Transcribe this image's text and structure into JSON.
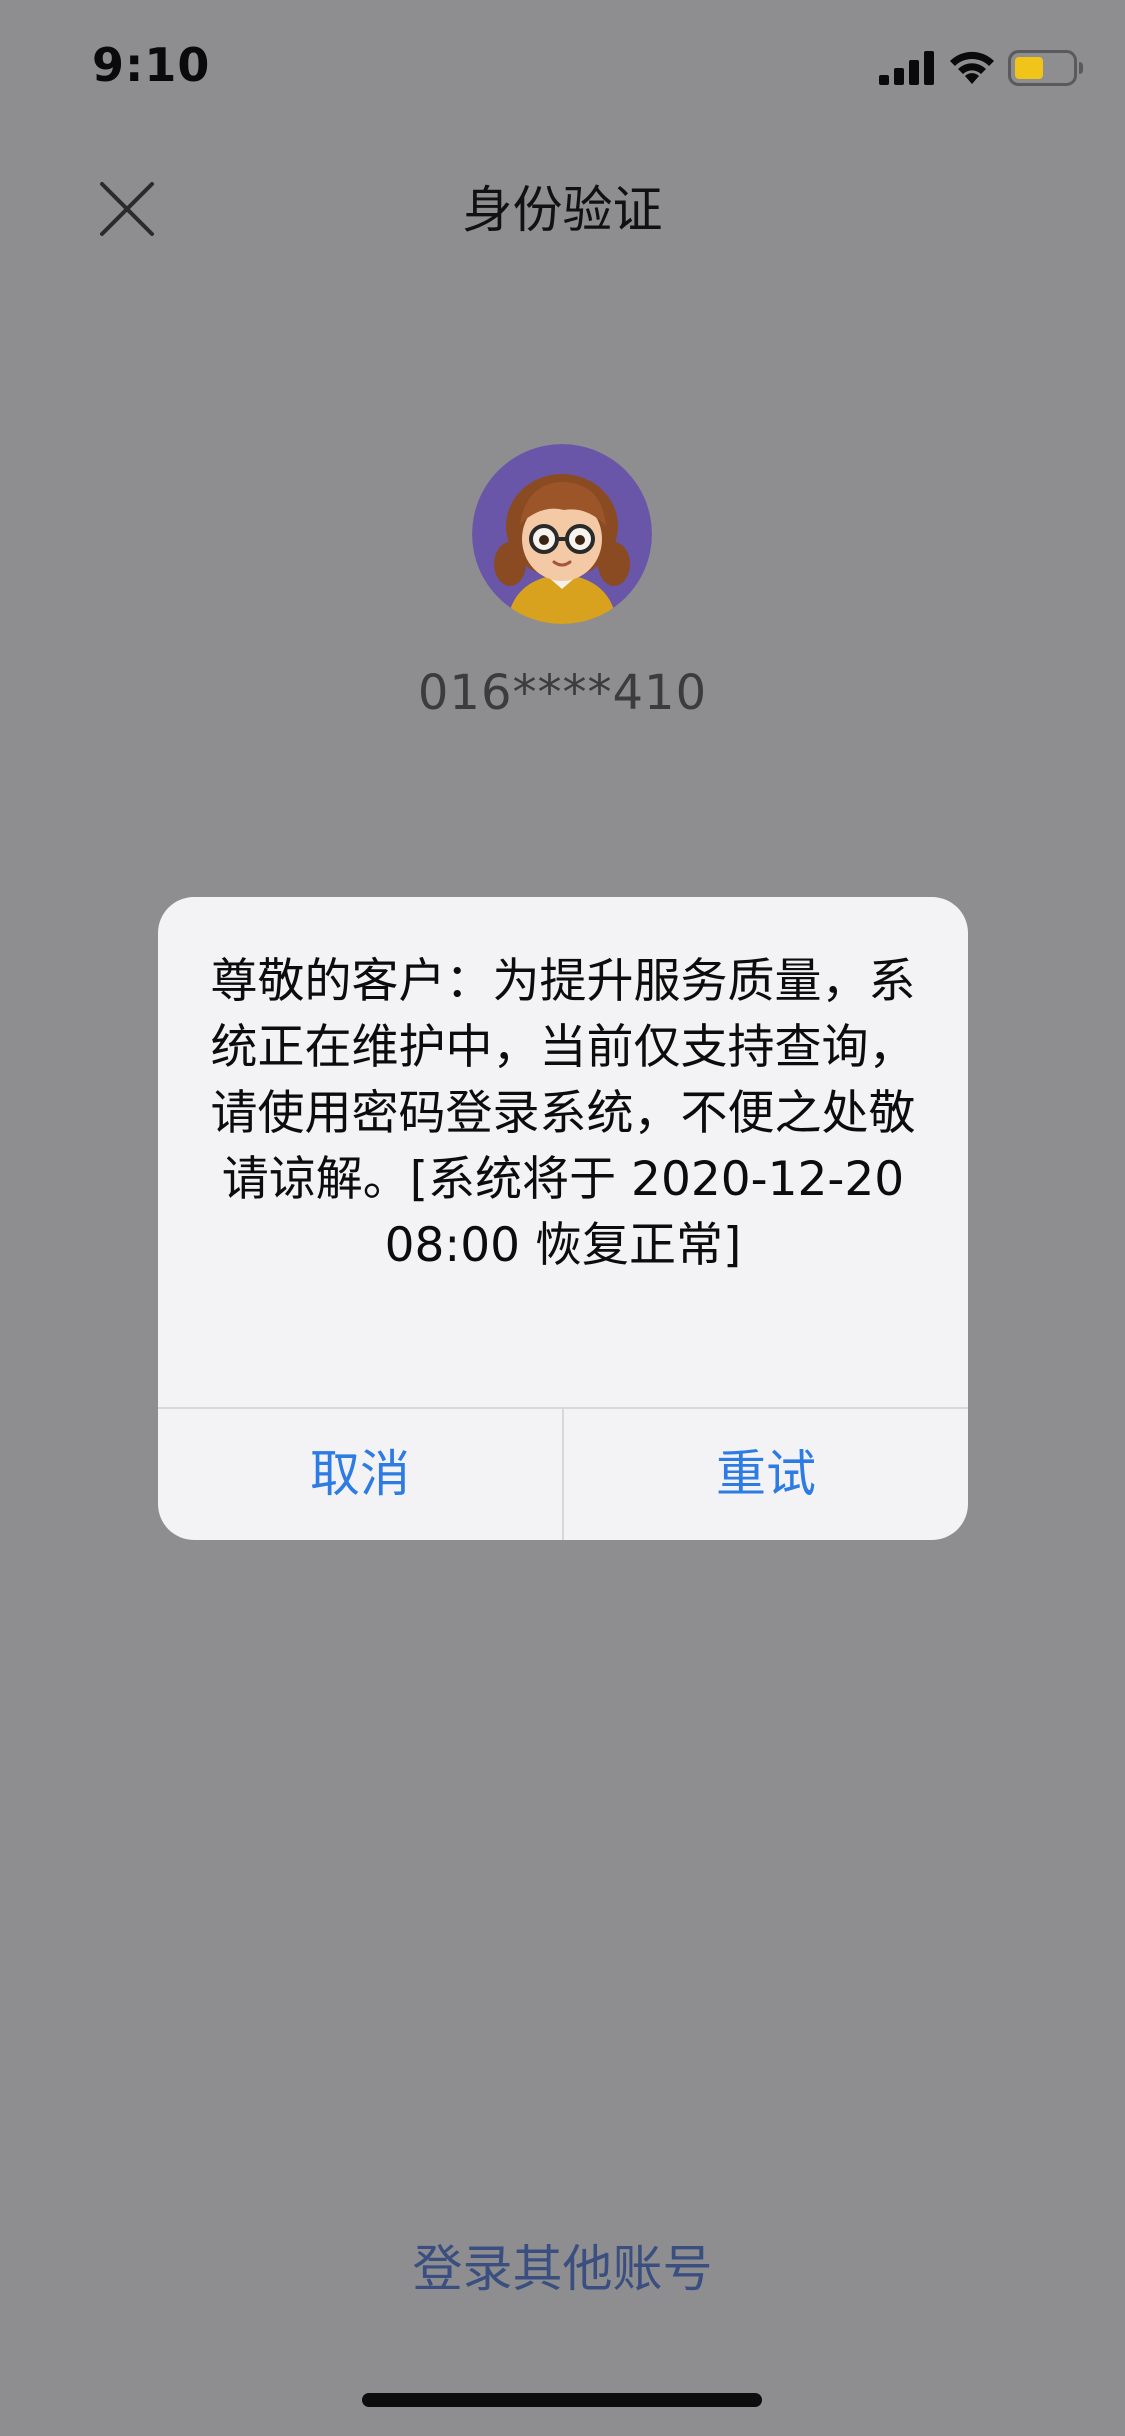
{
  "status_bar": {
    "time": "9:10",
    "icons": [
      "signal-icon",
      "wifi-icon",
      "battery-icon"
    ],
    "battery_color": "#f0c419"
  },
  "nav": {
    "title": "身份验证",
    "close_icon": "close-icon"
  },
  "profile": {
    "account": "016****410",
    "avatar_background": "#6a56a8"
  },
  "alert": {
    "message": "尊敬的客户：为提升服务质量，系统正在维护中，当前仅支持查询，请使用密码登录系统，不便之处敬请谅解。[系统将于 2020-12-20 08:00 恢复正常]",
    "cancel_label": "取消",
    "retry_label": "重试",
    "button_color": "#2d7be3"
  },
  "footer": {
    "other_account_label": "登录其他账号"
  }
}
